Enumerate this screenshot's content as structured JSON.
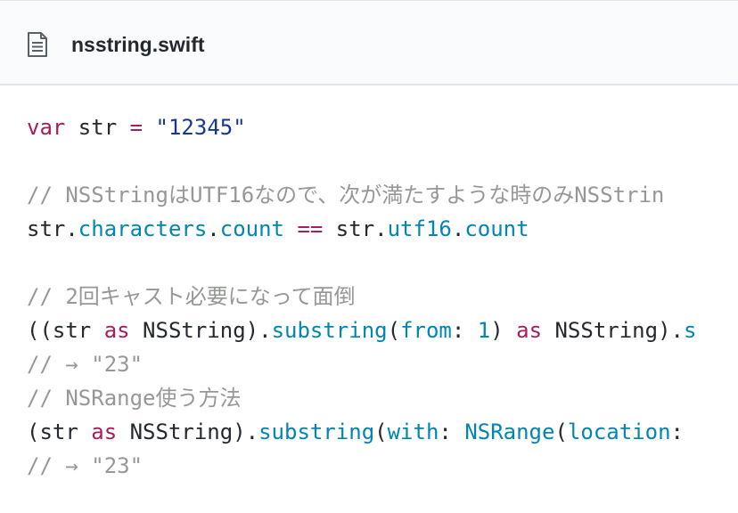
{
  "file": {
    "name": "nsstring.swift",
    "icon": "file-icon"
  },
  "colors": {
    "keyword": "#a71d5d",
    "string": "#183691",
    "number": "#0086b3",
    "property": "#0086b3",
    "comment": "#969896",
    "text": "#24292e"
  },
  "code": {
    "line1": {
      "kw_var": "var",
      "t1": " str ",
      "op_eq": "=",
      "t2": " ",
      "str": "\"12345\""
    },
    "line3": {
      "comment": "// NSStringはUTF16なので、次が満たすような時のみNSStrin"
    },
    "line4": {
      "t1": "str.",
      "p1": "characters",
      "t2": ".",
      "p2": "count",
      "t3": " ",
      "op": "==",
      "t4": " str.",
      "p3": "utf16",
      "t5": ".",
      "p4": "count"
    },
    "line6": {
      "comment": "// 2回キャスト必要になって面倒"
    },
    "line7": {
      "t1": "((str ",
      "kw1": "as",
      "t2": " NSString).",
      "f1": "substring",
      "t3": "(",
      "lbl": "from",
      "t4": ": ",
      "num": "1",
      "t5": ") ",
      "kw2": "as",
      "t6": " NSString).",
      "f2": "s"
    },
    "line8": {
      "comment": "// → \"23\""
    },
    "line9": {
      "comment": "// NSRange使う方法"
    },
    "line10": {
      "t1": "(str ",
      "kw1": "as",
      "t2": " NSString).",
      "f1": "substring",
      "t3": "(",
      "lbl": "with",
      "t4": ": ",
      "f2": "NSRange",
      "t5": "(",
      "lbl2": "location",
      "t6": ":"
    },
    "line11": {
      "comment": "// → \"23\""
    }
  }
}
